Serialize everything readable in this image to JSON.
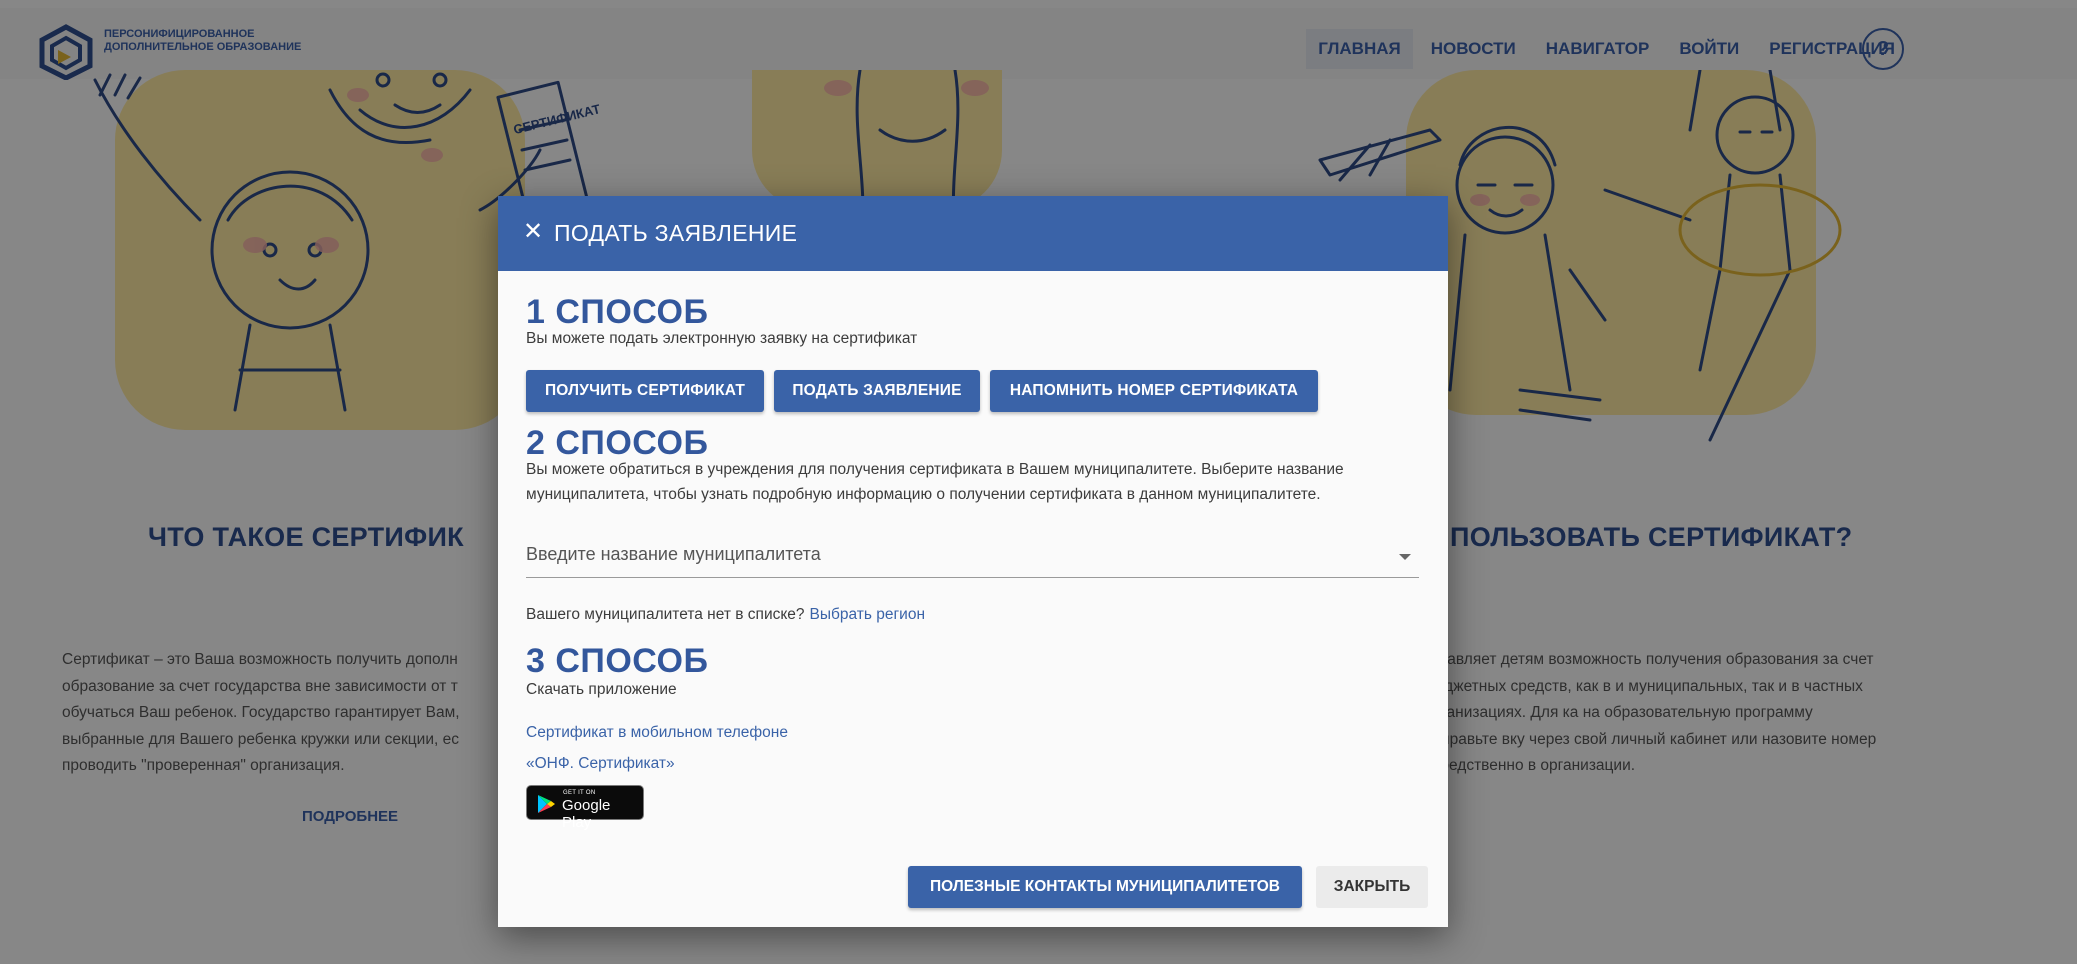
{
  "header": {
    "logo_text": "ПЕРСОНИФИЦИРОВАННОЕ ДОПОЛНИТЕЛЬНОЕ ОБРАЗОВАНИЕ",
    "nav": [
      "ГЛАВНАЯ",
      "НОВОСТИ",
      "НАВИГАТОР",
      "ВОЙТИ",
      "РЕГИСТРАЦИЯ"
    ],
    "help_label": "?"
  },
  "hero": {
    "illustration_label": "СЕРТИФИКАТ"
  },
  "content": {
    "left_title": "ЧТО ТАКОЕ СЕРТИФИК",
    "left_text": "Сертификат – это Ваша возможность получить дополн образование за счет государства вне зависимости от т обучаться Ваш ребенок. Государство гарантирует Вам, выбранные для Вашего ребенка кружки или секции, ес проводить \"проверенная\" организация.",
    "more_link": "ПОДРОБНЕЕ",
    "right_title": "ПОЛЬЗОВАТЬ СЕРТИФИКАТ?",
    "right_text": "оставляет детям возможность получения образования за счет бюджетных средств, как в и муниципальных, так и в частных организациях. Для ка на образовательную программу направьте вку через свой личный кабинет или назовите номер осредственно в организации."
  },
  "modal": {
    "title": "ПОДАТЬ ЗАЯВЛЕНИЕ",
    "way1": {
      "title": "1 СПОСОБ",
      "desc": "Вы можете подать электронную заявку на сертификат",
      "buttons": [
        "ПОЛУЧИТЬ СЕРТИФИКАТ",
        "ПОДАТЬ ЗАЯВЛЕНИЕ",
        "НАПОМНИТЬ НОМЕР СЕРТИФИКАТА"
      ]
    },
    "way2": {
      "title": "2 СПОСОБ",
      "desc": "Вы можете обратиться в учреждения для получения сертификата в Вашем муниципалитете. Выберите название муниципалитета, чтобы узнать подробную информацию о получении сертификата в данном муниципалитете.",
      "select_placeholder": "Введите название муниципалитета",
      "not_listed": "Вашего муниципалитета нет в списке?",
      "choose_region": "Выбрать регион"
    },
    "way3": {
      "title": "3 СПОСОБ",
      "desc": "Скачать приложение",
      "link1": "Сертификат в мобильном телефоне",
      "link2": "«ОНФ. Сертификат»",
      "store_small": "GET IT ON",
      "store_name": "Google Play"
    },
    "footer": {
      "contacts": "ПОЛЕЗНЫЕ КОНТАКТЫ МУНИЦИПАЛИТЕТОВ",
      "close": "ЗАКРЫТЬ"
    }
  },
  "colors": {
    "primary": "#3a63a8",
    "hero_yellow": "#fbe7a1",
    "overlay": "rgba(0,0,0,0.46)"
  }
}
